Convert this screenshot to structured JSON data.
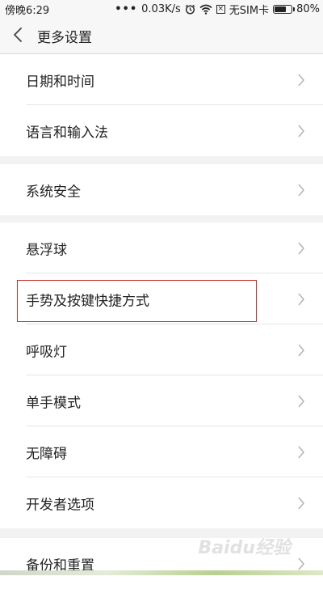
{
  "status_bar": {
    "time": "傍晚6:29",
    "dots": "•••",
    "speed": "0.03K/s",
    "alarm_icon": "alarm-icon",
    "wifi_icon": "wifi-icon",
    "no_sim": "无SIM卡",
    "battery_percent": "80%",
    "battery_level": 0.8
  },
  "header": {
    "title": "更多设置",
    "back_icon": "back-arrow-icon"
  },
  "groups": [
    {
      "items": [
        {
          "label": "日期和时间"
        },
        {
          "label": "语言和输入法"
        }
      ]
    },
    {
      "items": [
        {
          "label": "系统安全"
        }
      ]
    },
    {
      "items": [
        {
          "label": "悬浮球"
        },
        {
          "label": "手势及按键快捷方式"
        },
        {
          "label": "呼吸灯"
        },
        {
          "label": "单手模式"
        },
        {
          "label": "无障碍"
        },
        {
          "label": "开发者选项"
        }
      ]
    },
    {
      "items": [
        {
          "label": "备份和重置"
        }
      ]
    }
  ],
  "highlight_color": "#c4302b",
  "watermark": "Baidu经验"
}
